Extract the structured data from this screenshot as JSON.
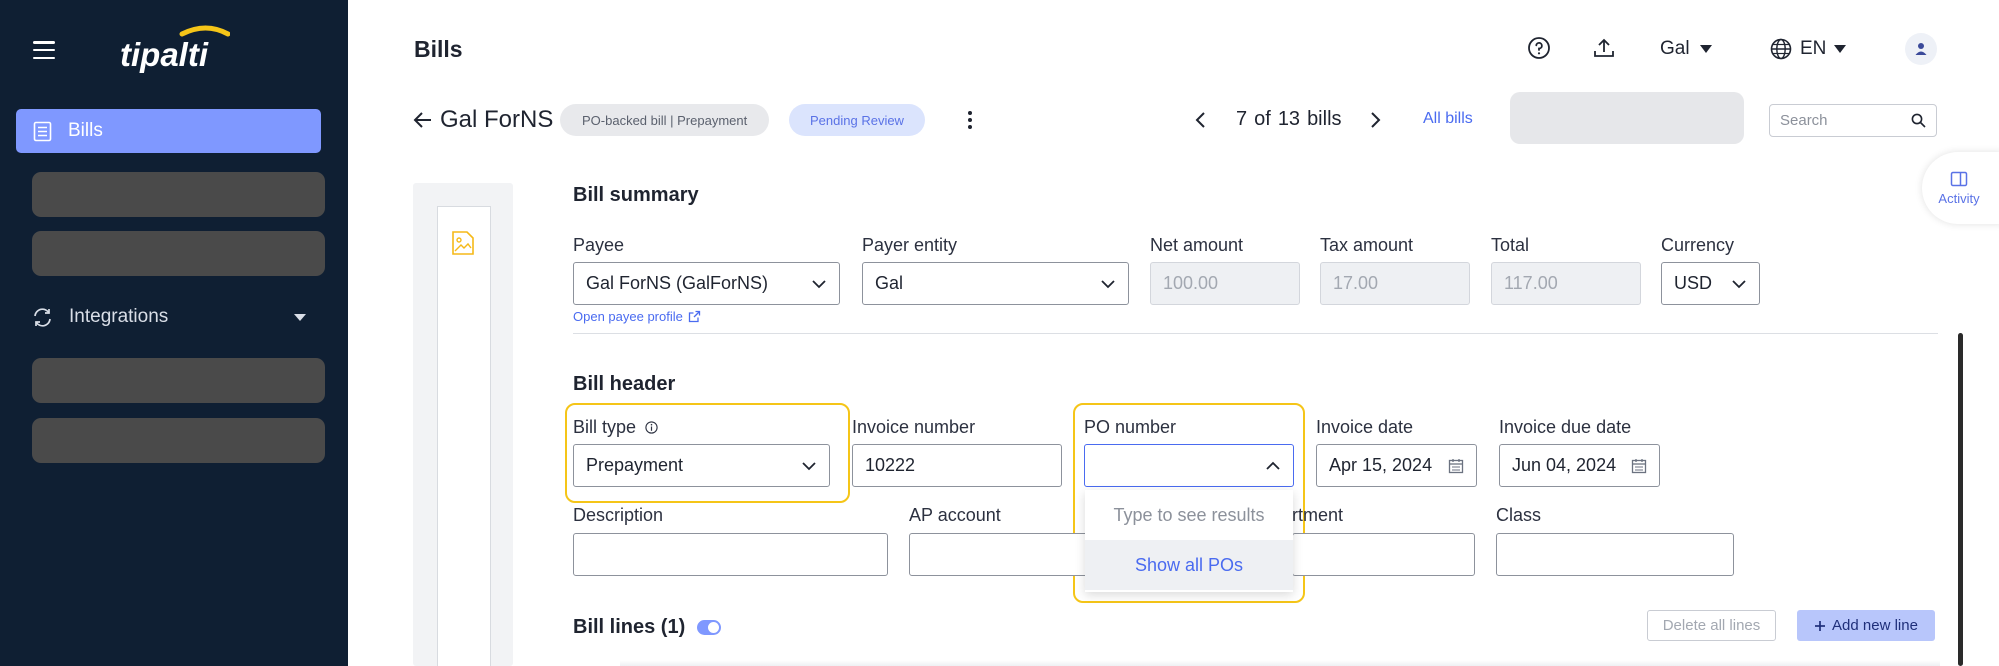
{
  "colors": {
    "sidebar_bg": "#0f1f33",
    "accent": "#7f98ff",
    "link": "#4a6bf0",
    "highlight": "#f5c518"
  },
  "sidebar": {
    "logo": "tipalti",
    "items": [
      {
        "label": "Bills",
        "icon": "bill-list-icon",
        "active": true
      },
      {
        "label": "Integrations",
        "icon": "sync-icon",
        "expandable": true
      }
    ]
  },
  "header": {
    "title": "Bills",
    "user": "Gal",
    "language": "EN"
  },
  "bill": {
    "name": "Gal ForNS",
    "type_badge": "PO-backed bill | Prepayment",
    "status_badge": "Pending Review",
    "pager": {
      "current": "7",
      "of": "of",
      "total": "13",
      "unit": "bills"
    },
    "all_bills_label": "All bills",
    "search_placeholder": "Search"
  },
  "activity_label": "Activity",
  "summary": {
    "title": "Bill summary",
    "payee_label": "Payee",
    "payee_value": "Gal ForNS (GalForNS)",
    "open_payee_link": "Open payee profile",
    "payer_label": "Payer entity",
    "payer_value": "Gal",
    "net_label": "Net amount",
    "net_value": "100.00",
    "tax_label": "Tax amount",
    "tax_value": "17.00",
    "total_label": "Total",
    "total_value": "117.00",
    "currency_label": "Currency",
    "currency_value": "USD"
  },
  "bill_header": {
    "title": "Bill header",
    "bill_type_label": "Bill type",
    "bill_type_value": "Prepayment",
    "invoice_number_label": "Invoice number",
    "invoice_number_value": "10222",
    "po_label": "PO number",
    "po_value": "",
    "po_dropdown_hint": "Type to see results",
    "po_dropdown_option": "Show all POs",
    "invoice_date_label": "Invoice date",
    "invoice_date_value": "Apr 15, 2024",
    "due_date_label": "Invoice due date",
    "due_date_value": "Jun 04, 2024",
    "description_label": "Description",
    "ap_account_label": "AP account",
    "department_label_partial": "rtment",
    "class_label": "Class"
  },
  "bill_lines": {
    "title": "Bill lines (1)",
    "delete_all_label": "Delete all lines",
    "add_line_label": "Add new line"
  }
}
